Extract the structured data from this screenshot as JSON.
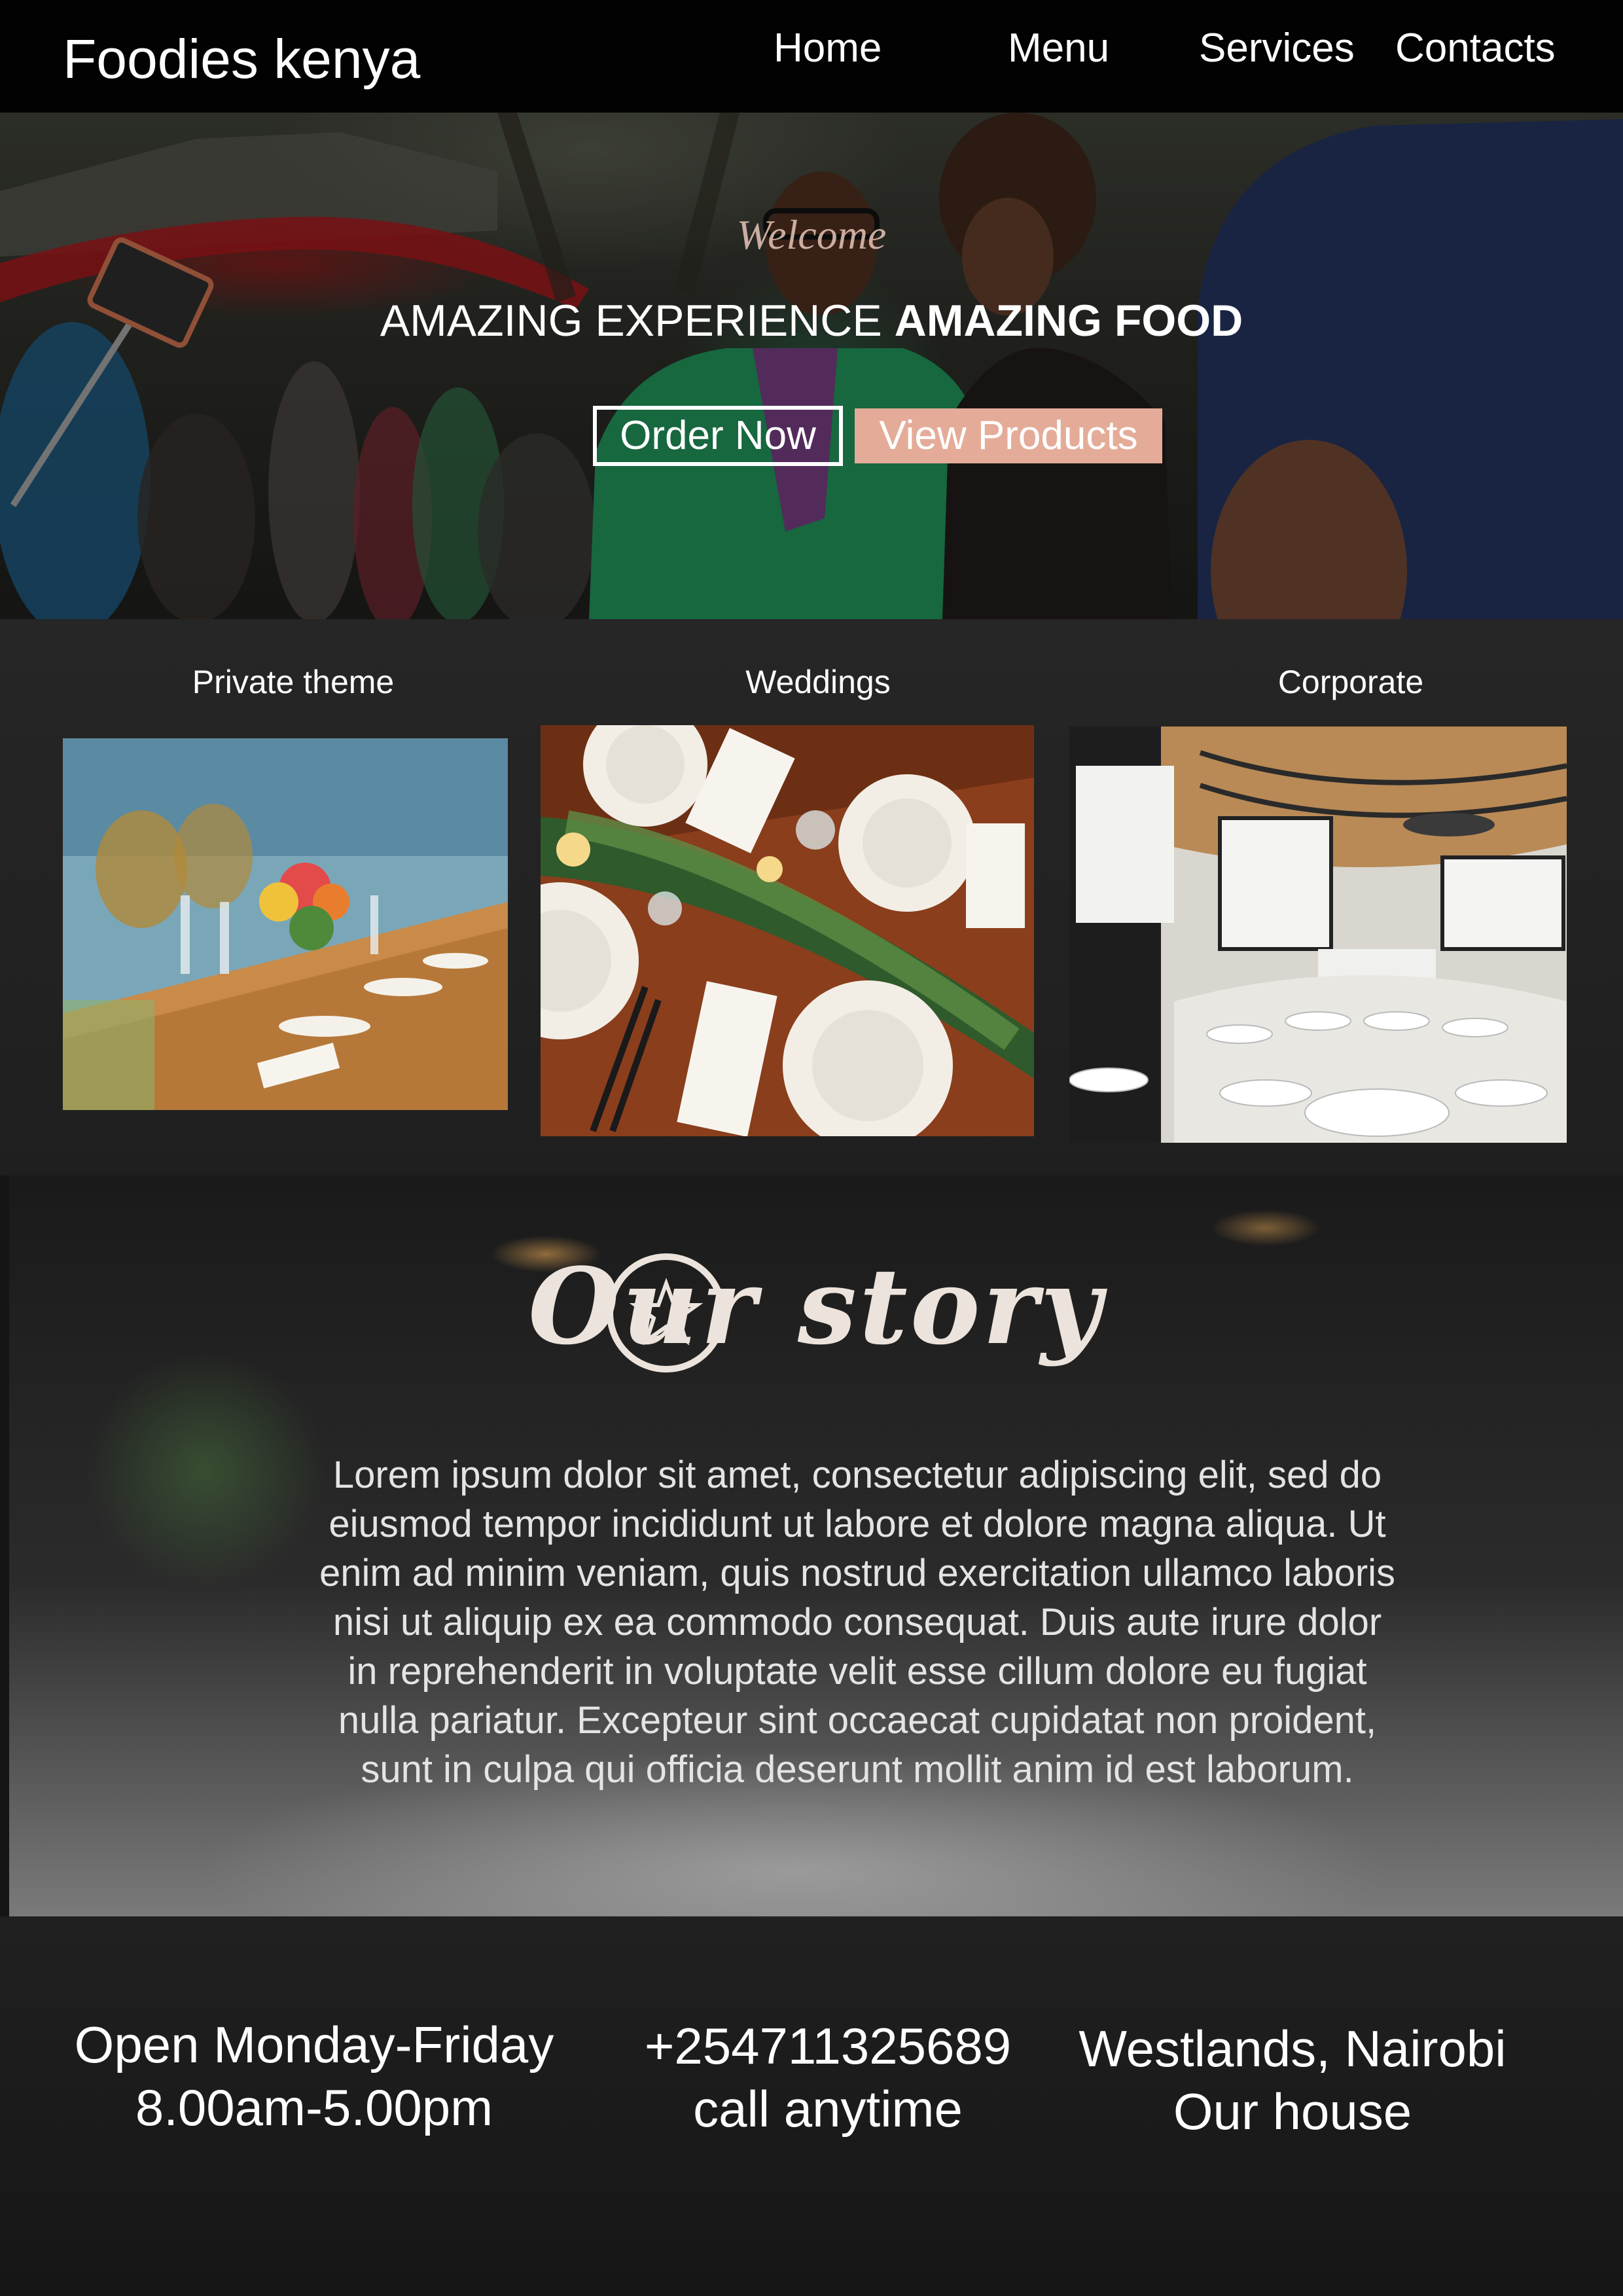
{
  "nav": {
    "brand": "Foodies kenya",
    "links": [
      "Home",
      "Menu",
      "Services",
      "Contacts"
    ]
  },
  "hero": {
    "welcome": "Welcome",
    "headline_regular": "AMAZING EXPERIENCE",
    "headline_bold": "AMAZING FOOD",
    "order_button": "Order Now",
    "products_button": "View Products"
  },
  "services": [
    {
      "title": "Private theme"
    },
    {
      "title": "Weddings"
    },
    {
      "title": "Corporate"
    }
  ],
  "story": {
    "heading": "Our story",
    "body": "Lorem ipsum dolor sit amet, consectetur adipiscing elit, sed do eiusmod tempor incididunt ut labore et dolore magna aliqua. Ut enim ad minim veniam, quis nostrud exercitation ullamco laboris nisi ut aliquip ex ea commodo consequat. Duis aute irure dolor in reprehenderit in voluptate velit esse cillum dolore eu fugiat nulla pariatur. Excepteur sint occaecat cupidatat non proident, sunt in culpa qui officia deserunt mollit anim id est laborum."
  },
  "info": {
    "hours_line1": "Open Monday-Friday",
    "hours_line2": "8.00am-5.00pm",
    "phone_line1": "+254711325689",
    "phone_line2": "call anytime",
    "location_line1": "Westlands, Nairobi",
    "location_line2": "Our house"
  },
  "colors": {
    "nav_bg": "#020202",
    "accent_button": "#e4ac98",
    "page_bg": "#151515"
  }
}
